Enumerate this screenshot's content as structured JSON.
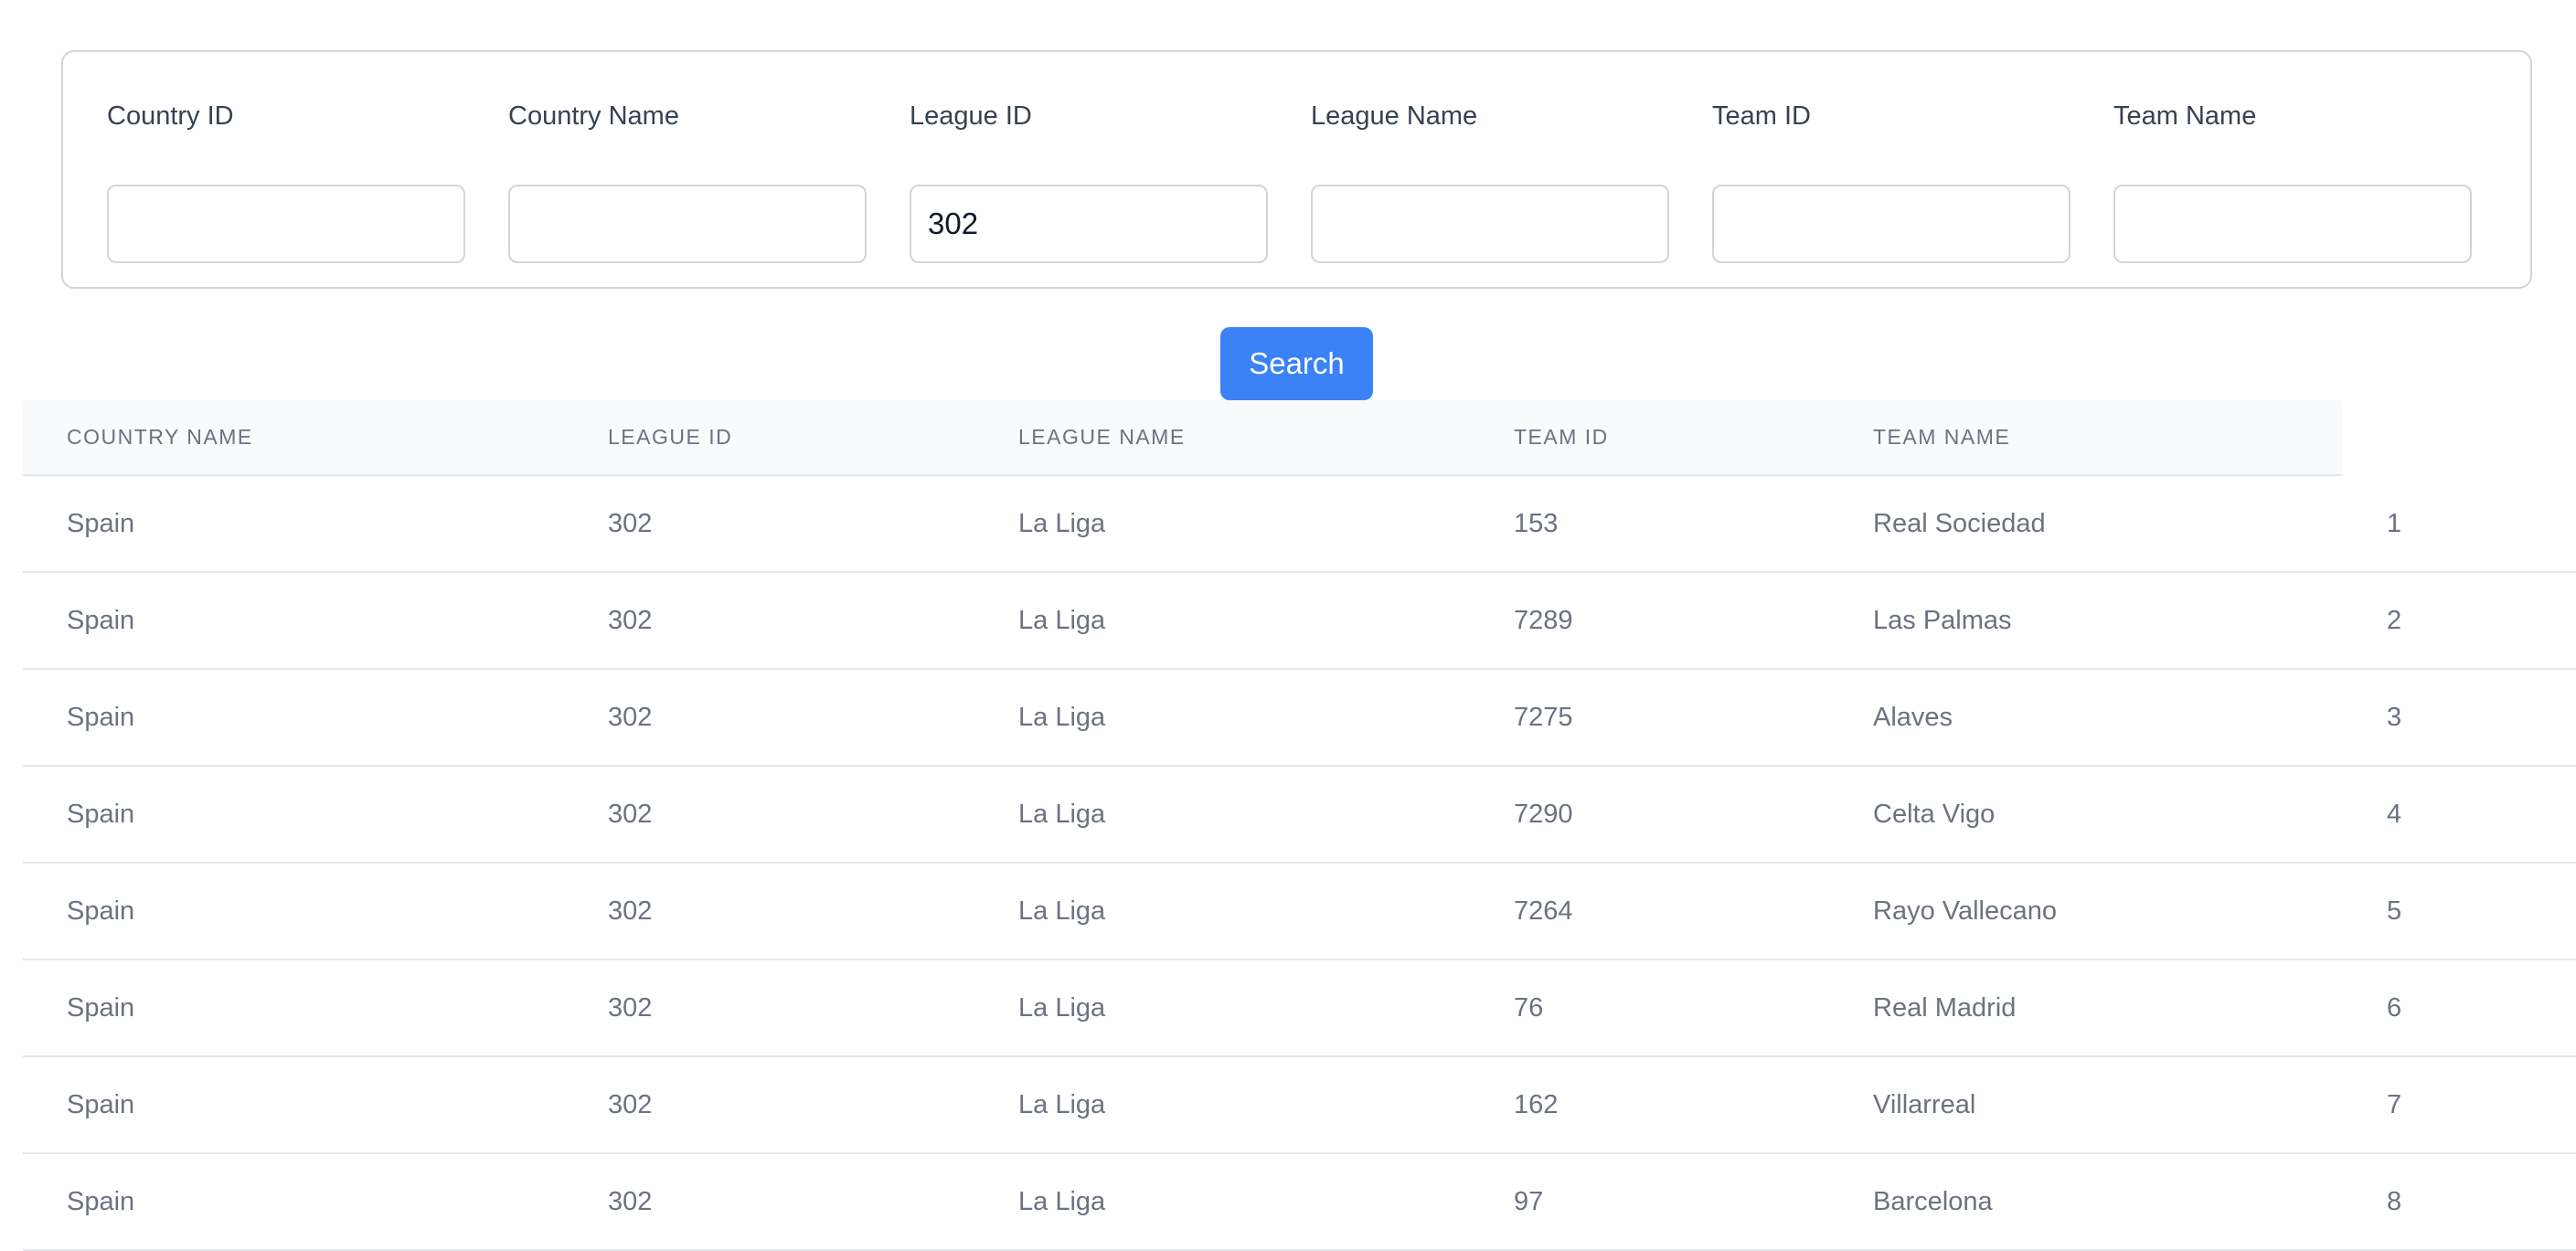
{
  "filters": [
    {
      "label": "Country ID",
      "value": "",
      "name": "country-id"
    },
    {
      "label": "Country Name",
      "value": "",
      "name": "country-name"
    },
    {
      "label": "League ID",
      "value": "302",
      "name": "league-id"
    },
    {
      "label": "League Name",
      "value": "",
      "name": "league-name"
    },
    {
      "label": "Team ID",
      "value": "",
      "name": "team-id"
    },
    {
      "label": "Team Name",
      "value": "",
      "name": "team-name"
    }
  ],
  "search_label": "Search",
  "table": {
    "headers": [
      "Country Name",
      "League ID",
      "League Name",
      "Team ID",
      "Team Name"
    ],
    "rows": [
      [
        "Spain",
        "302",
        "La Liga",
        "153",
        "Real Sociedad",
        "1"
      ],
      [
        "Spain",
        "302",
        "La Liga",
        "7289",
        "Las Palmas",
        "2"
      ],
      [
        "Spain",
        "302",
        "La Liga",
        "7275",
        "Alaves",
        "3"
      ],
      [
        "Spain",
        "302",
        "La Liga",
        "7290",
        "Celta Vigo",
        "4"
      ],
      [
        "Spain",
        "302",
        "La Liga",
        "7264",
        "Rayo Vallecano",
        "5"
      ],
      [
        "Spain",
        "302",
        "La Liga",
        "76",
        "Real Madrid",
        "6"
      ],
      [
        "Spain",
        "302",
        "La Liga",
        "162",
        "Villarreal",
        "7"
      ],
      [
        "Spain",
        "302",
        "La Liga",
        "97",
        "Barcelona",
        "8"
      ]
    ]
  },
  "colors": {
    "accent": "#3b82f6",
    "border": "#d1d5db",
    "header_bg": "#f9fafb",
    "muted_text": "#6b7280"
  }
}
